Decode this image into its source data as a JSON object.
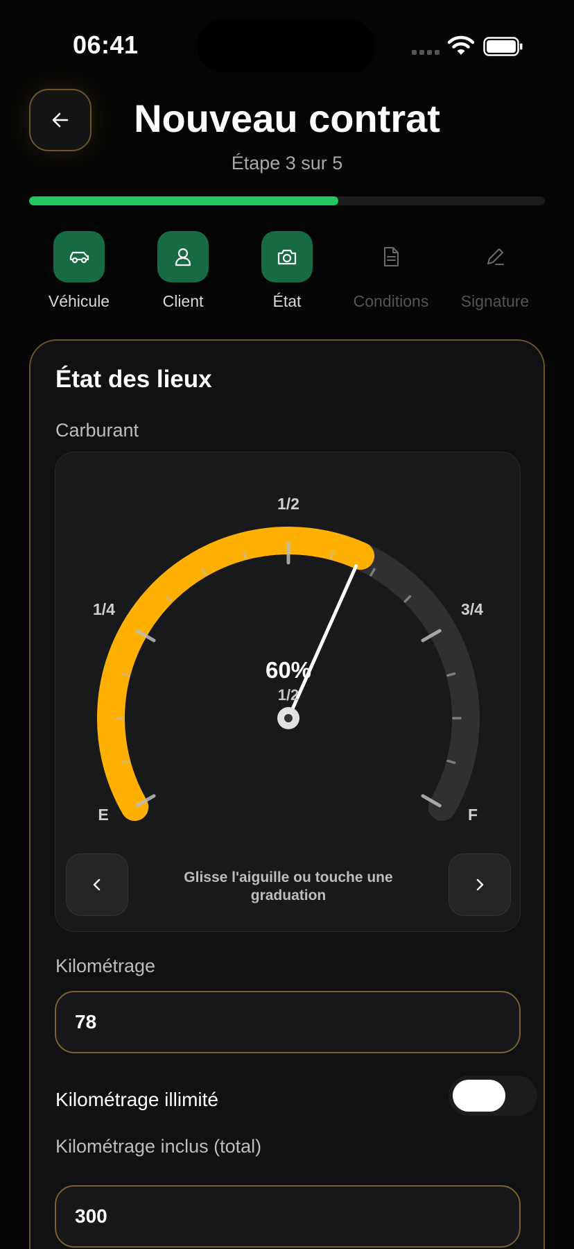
{
  "status_bar": {
    "time": "06:41"
  },
  "header": {
    "title": "Nouveau contrat",
    "subtitle": "Étape 3 sur 5",
    "progress": 0.6
  },
  "steps": [
    {
      "label": "Véhicule",
      "icon": "car-icon",
      "state": "done"
    },
    {
      "label": "Client",
      "icon": "user-icon",
      "state": "done"
    },
    {
      "label": "État",
      "icon": "camera-icon",
      "state": "done"
    },
    {
      "label": "Conditions",
      "icon": "document-icon",
      "state": "todo"
    },
    {
      "label": "Signature",
      "icon": "pen-icon",
      "state": "todo"
    }
  ],
  "card": {
    "title": "État des lieux",
    "fuel": {
      "label": "Carburant",
      "percent_label": "60%",
      "level_label": "1/2",
      "level": 0.6,
      "marks": {
        "empty": "E",
        "quarter": "1/4",
        "half": "1/2",
        "three_quarter": "3/4",
        "full": "F"
      },
      "hint": "Glisse l'aiguille ou touche une graduation",
      "colors": {
        "fill": "#FFB000",
        "track": "#303033",
        "needle": "#FFFFFF"
      }
    },
    "mileage": {
      "label": "Kilométrage",
      "value": "78"
    },
    "unlimited": {
      "label": "Kilométrage illimité",
      "enabled": false
    },
    "included": {
      "label": "Kilométrage inclus (total)",
      "value": "300"
    }
  }
}
